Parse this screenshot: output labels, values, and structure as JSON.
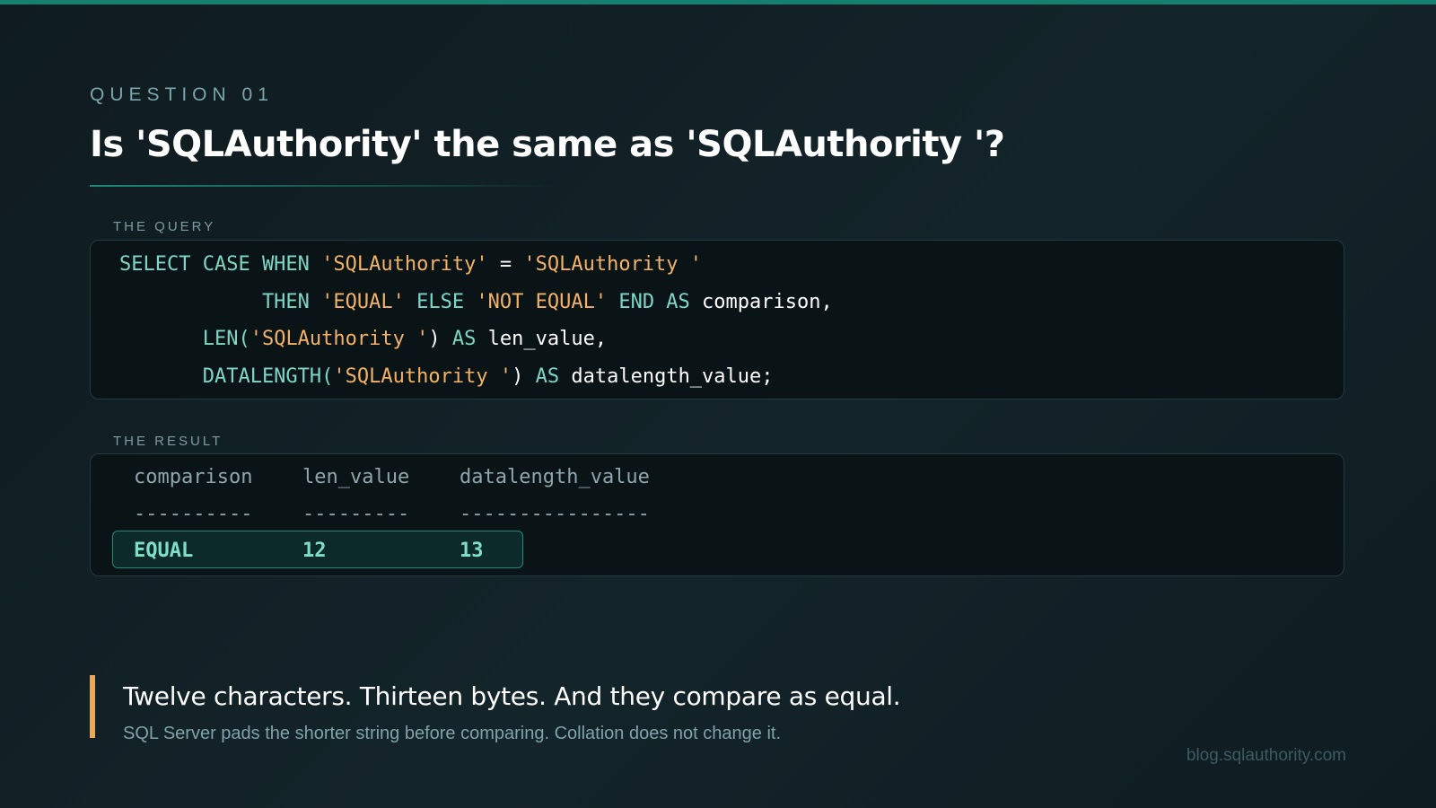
{
  "eyebrow": "QUESTION 01",
  "title": "Is 'SQLAuthority' the same as 'SQLAuthority '?",
  "query_label": "THE QUERY",
  "query_lines": [
    [
      {
        "t": "SELECT CASE WHEN ",
        "c": "kw"
      },
      {
        "t": "'SQLAuthority'",
        "c": "str"
      },
      {
        "t": " = ",
        "c": "plain"
      },
      {
        "t": "'SQLAuthority '",
        "c": "str"
      }
    ],
    [
      {
        "t": "            THEN ",
        "c": "kw"
      },
      {
        "t": "'EQUAL'",
        "c": "str"
      },
      {
        "t": " ELSE ",
        "c": "kw"
      },
      {
        "t": "'NOT EQUAL'",
        "c": "str"
      },
      {
        "t": " END AS ",
        "c": "kw"
      },
      {
        "t": "comparison,",
        "c": "plain"
      }
    ],
    [
      {
        "t": "       LEN(",
        "c": "kw"
      },
      {
        "t": "'SQLAuthority '",
        "c": "str"
      },
      {
        "t": ") ",
        "c": "plain"
      },
      {
        "t": "AS ",
        "c": "kw"
      },
      {
        "t": "len_value,",
        "c": "plain"
      }
    ],
    [
      {
        "t": "       DATALENGTH(",
        "c": "kw"
      },
      {
        "t": "'SQLAuthority '",
        "c": "str"
      },
      {
        "t": ") ",
        "c": "plain"
      },
      {
        "t": "AS ",
        "c": "kw"
      },
      {
        "t": "datalength_value;",
        "c": "plain"
      }
    ]
  ],
  "result_label": "THE RESULT",
  "result": {
    "columns": [
      "comparison",
      "len_value",
      "datalength_value"
    ],
    "separators": [
      "----------",
      "---------",
      "----------------"
    ],
    "row": [
      "EQUAL",
      "12",
      "13"
    ]
  },
  "takeaway": "Twelve characters. Thirteen bytes. And they compare as equal.",
  "note": "SQL Server pads the shorter string before comparing. Collation does not change it.",
  "footer_url": "blog.sqlauthority.com",
  "colors": {
    "accent": "#14806f",
    "keyword": "#7ed7c4",
    "string": "#f4b266",
    "result_value": "#7fe0c6",
    "callout_bar": "#e8a85d"
  }
}
